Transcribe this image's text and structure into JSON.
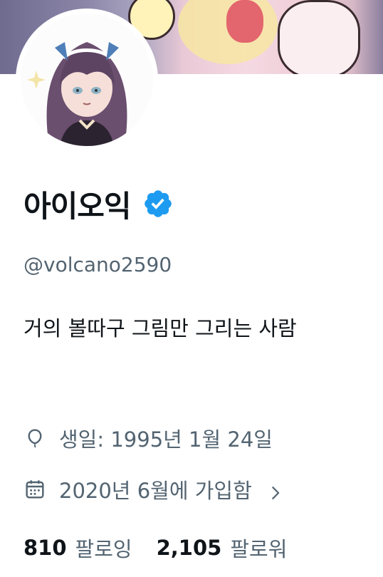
{
  "profile": {
    "display_name": "아이오익",
    "handle": "@volcano2590",
    "bio": "거의 볼따구 그림만 그리는 사람",
    "verified": true
  },
  "meta": {
    "birthday": "생일: 1995년 1월 24일",
    "joined": "2020년 6월에 가입함"
  },
  "stats": {
    "following_count": "810",
    "following_label": "팔로잉",
    "followers_count": "2,105",
    "followers_label": "팔로워"
  },
  "icons": {
    "verified": "verified-badge-icon",
    "birthday": "balloon-icon",
    "joined": "calendar-icon",
    "more": "chevron-right-icon"
  },
  "colors": {
    "verified_blue": "#1d9bf0",
    "text_primary": "#0f1419",
    "text_secondary": "#536471"
  }
}
